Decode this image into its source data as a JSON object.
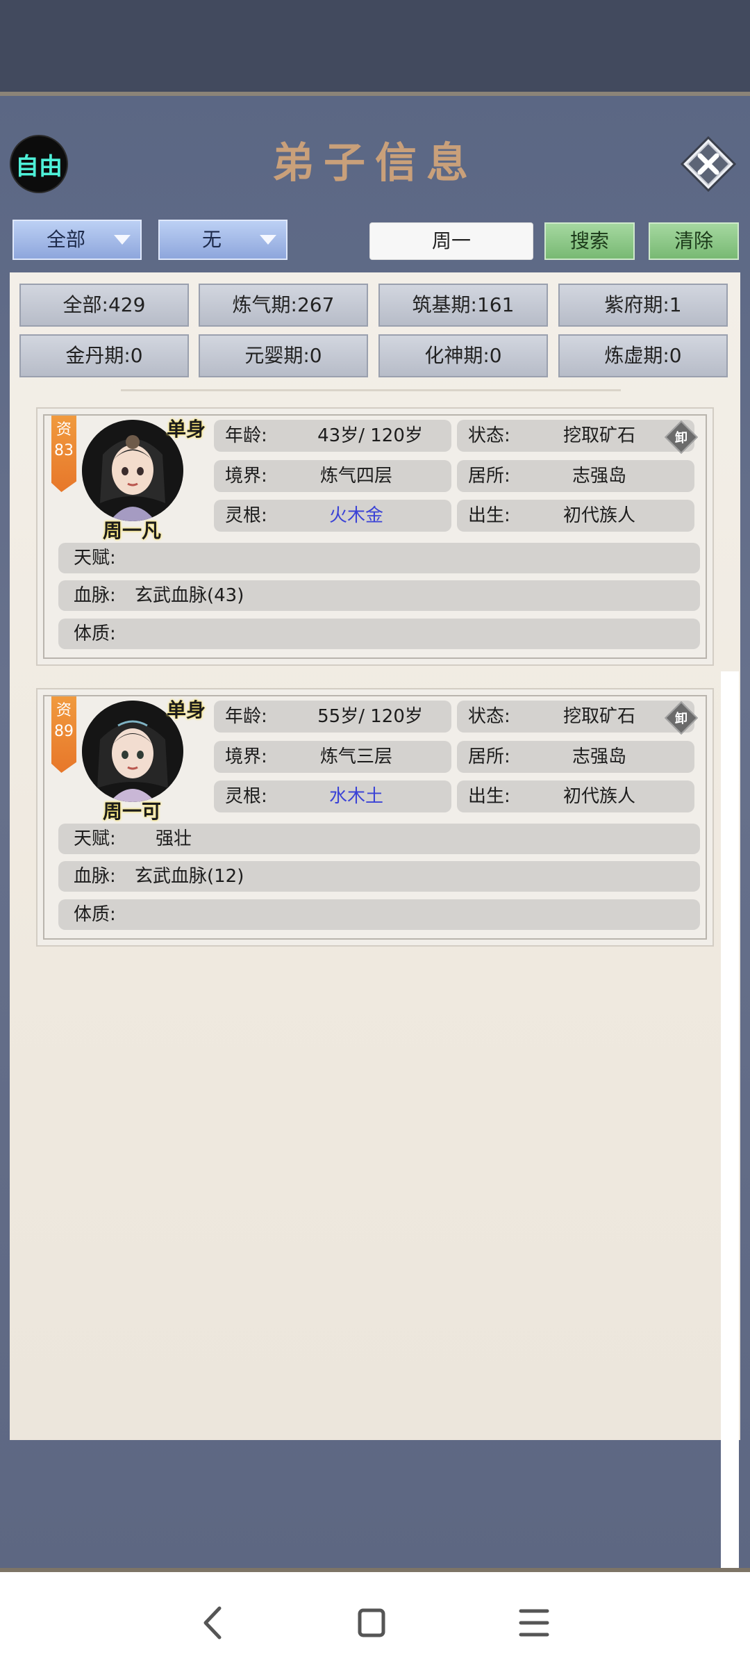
{
  "header": {
    "free_label": "自由",
    "title": "弟子信息"
  },
  "filters": {
    "dropdown1": "全部",
    "dropdown2": "无",
    "search_value": "周一",
    "search_label": "搜索",
    "clear_label": "清除"
  },
  "stats": [
    "全部:429",
    "炼气期:267",
    "筑基期:161",
    "紫府期:1",
    "金丹期:0",
    "元婴期:0",
    "化神期:0",
    "炼虚期:0"
  ],
  "disciples": [
    {
      "aptitude_label": "资",
      "aptitude": "83",
      "marital": "单身",
      "name": "周一凡",
      "age_label": "年龄:",
      "age": "43岁/ 120岁",
      "status_label": "状态:",
      "status": "挖取矿石",
      "realm_label": "境界:",
      "realm": "炼气四层",
      "residence_label": "居所:",
      "residence": "志强岛",
      "root_label": "灵根:",
      "root": "火木金",
      "birth_label": "出生:",
      "birth": "初代族人",
      "talent_label": "天赋:",
      "talent": "",
      "bloodline_label": "血脉:",
      "bloodline": "玄武血脉(43)",
      "physique_label": "体质:",
      "physique": "",
      "unload_label": "卸"
    },
    {
      "aptitude_label": "资",
      "aptitude": "89",
      "marital": "单身",
      "name": "周一可",
      "age_label": "年龄:",
      "age": "55岁/ 120岁",
      "status_label": "状态:",
      "status": "挖取矿石",
      "realm_label": "境界:",
      "realm": "炼气三层",
      "residence_label": "居所:",
      "residence": "志强岛",
      "root_label": "灵根:",
      "root": "水木土",
      "birth_label": "出生:",
      "birth": "初代族人",
      "talent_label": "天赋:",
      "talent": "强壮",
      "bloodline_label": "血脉:",
      "bloodline": "玄武血脉(12)",
      "physique_label": "体质:",
      "physique": "",
      "unload_label": "卸"
    }
  ],
  "icons": {
    "close": "close-icon",
    "back": "back-icon",
    "home": "home-icon",
    "menu": "menu-icon"
  }
}
